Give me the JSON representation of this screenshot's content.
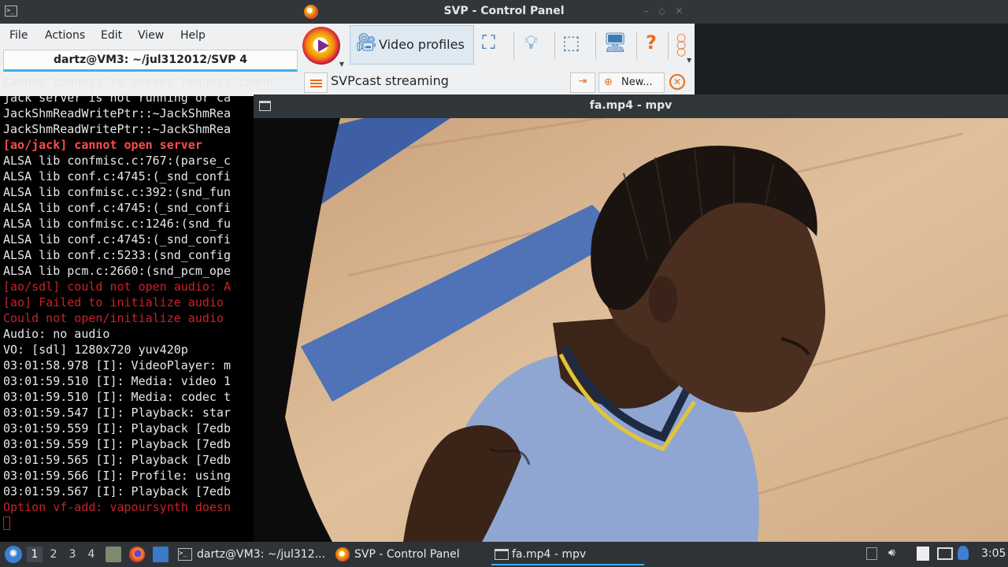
{
  "svp_window": {
    "title": "SVP - Control Panel",
    "tab_video_profiles": "Video profiles",
    "profile_name": "SVPcast streaming",
    "new_button": "New...",
    "help_glyph": "?"
  },
  "terminal": {
    "menu": [
      "File",
      "Actions",
      "Edit",
      "View",
      "Help"
    ],
    "tab_title": "dartz@VM3: ~/jul312012/SVP 4",
    "lines": [
      {
        "text": "Cannot connect to server request chann",
        "style": "normal"
      },
      {
        "text": "jack server is not running or ca",
        "style": "normal"
      },
      {
        "text": "JackShmReadWritePtr::~JackShmRea",
        "style": "normal"
      },
      {
        "text": "JackShmReadWritePtr::~JackShmRea",
        "style": "normal"
      },
      {
        "text": "[ao/jack] cannot open server",
        "style": "bold-red"
      },
      {
        "text": "ALSA lib confmisc.c:767:(parse_c",
        "style": "normal"
      },
      {
        "text": "ALSA lib conf.c:4745:(_snd_confi",
        "style": "normal"
      },
      {
        "text": "ALSA lib confmisc.c:392:(snd_fun",
        "style": "normal"
      },
      {
        "text": "ALSA lib conf.c:4745:(_snd_confi",
        "style": "normal"
      },
      {
        "text": "ALSA lib confmisc.c:1246:(snd_fu",
        "style": "normal"
      },
      {
        "text": "ALSA lib conf.c:4745:(_snd_confi",
        "style": "normal"
      },
      {
        "text": "ALSA lib conf.c:5233:(snd_config",
        "style": "normal"
      },
      {
        "text": "ALSA lib pcm.c:2660:(snd_pcm_ope",
        "style": "normal"
      },
      {
        "text": "[ao/sdl] could not open audio: A",
        "style": "red"
      },
      {
        "text": "[ao] Failed to initialize audio ",
        "style": "red"
      },
      {
        "text": "Could not open/initialize audio ",
        "style": "red"
      },
      {
        "text": "Audio: no audio",
        "style": "normal"
      },
      {
        "text": "VO: [sdl] 1280x720 yuv420p",
        "style": "normal"
      },
      {
        "text": "03:01:58.978 [I]: VideoPlayer: m",
        "style": "normal"
      },
      {
        "text": "03:01:59.510 [I]: Media: video 1",
        "style": "normal"
      },
      {
        "text": "03:01:59.510 [I]: Media: codec t",
        "style": "normal"
      },
      {
        "text": "03:01:59.547 [I]: Playback: star",
        "style": "normal"
      },
      {
        "text": "03:01:59.559 [I]: Playback [7edb",
        "style": "normal"
      },
      {
        "text": "03:01:59.559 [I]: Playback [7edb",
        "style": "normal"
      },
      {
        "text": "03:01:59.565 [I]: Playback [7edb",
        "style": "normal"
      },
      {
        "text": "03:01:59.566 [I]: Profile: using",
        "style": "normal"
      },
      {
        "text": "03:01:59.567 [I]: Playback [7edb",
        "style": "normal"
      },
      {
        "text": "Option vf-add: vapoursynth doesn",
        "style": "red"
      }
    ]
  },
  "mpv_window": {
    "title": "fa.mp4 - mpv"
  },
  "taskbar": {
    "desktops": [
      "1",
      "2",
      "3",
      "4"
    ],
    "active_desktop": "1",
    "tasks": [
      {
        "label": "dartz@VM3: ~/jul312...",
        "icon": "terminal-icon"
      },
      {
        "label": "SVP - Control Panel",
        "icon": "svp-icon"
      },
      {
        "label": "fa.mp4 - mpv",
        "icon": "window-icon",
        "active": true
      }
    ],
    "clock": "3:05"
  },
  "colors": {
    "accent": "#3daee9",
    "svp_orange": "#e76f1c",
    "svp_blue": "#3a7ab8",
    "terminal_red": "#c8222a",
    "terminal_bold_red": "#ff4c4c"
  }
}
